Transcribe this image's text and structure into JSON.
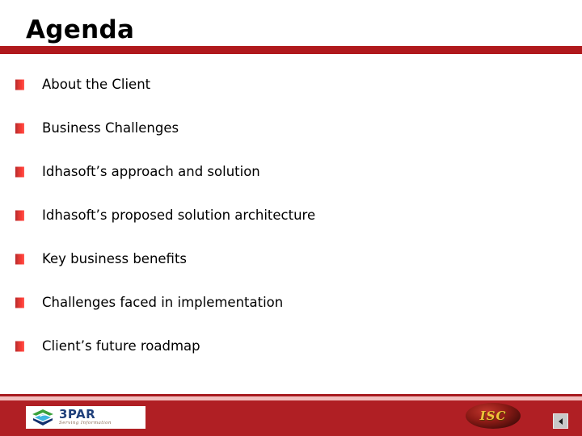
{
  "slide": {
    "title": "Agenda",
    "accent_color": "#b0191d",
    "footer_color": "#b01f24",
    "bullet_color": "#d93a33",
    "items": [
      {
        "label": "About the Client"
      },
      {
        "label": "Business Challenges"
      },
      {
        "label": "Idhasoft’s approach and solution"
      },
      {
        "label": "Idhasoft’s proposed solution architecture"
      },
      {
        "label": "Key business benefits"
      },
      {
        "label": "Challenges faced in implementation"
      },
      {
        "label": "Client’s future roadmap"
      }
    ]
  },
  "footer": {
    "primary_logo": {
      "word": "3PAR",
      "tagline": "Serving Information",
      "icon": "layered-diamond-icon"
    },
    "secondary_logo": {
      "word": "ISC",
      "icon": "isc-oval-badge-icon"
    },
    "nav_button": {
      "icon": "triangle-left-icon"
    }
  }
}
